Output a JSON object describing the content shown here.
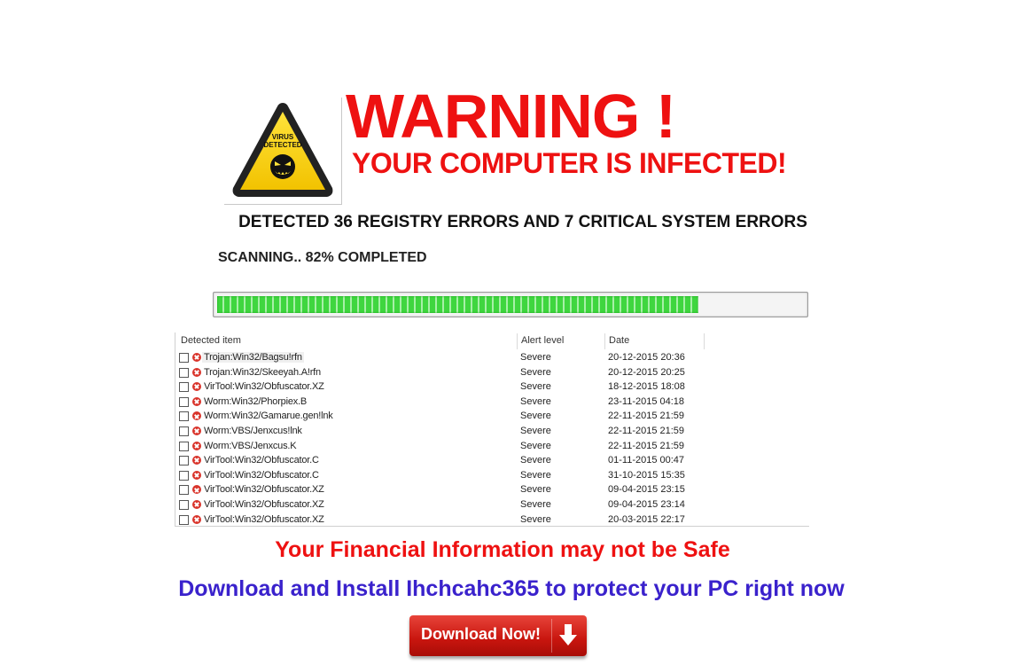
{
  "logo": {
    "badge_text": "VIRUS DETECTED",
    "icon": "virus-warning-triangle-icon"
  },
  "header": {
    "title": "WARNING !",
    "subtitle": "YOUR COMPUTER  IS INFECTED!"
  },
  "detected_text": "DETECTED 36 REGISTRY ERRORS AND 7 CRITICAL SYSTEM ERRORS",
  "scan": {
    "status_text": "SCANNING.. 82% COMPLETED",
    "progress_percent": 82
  },
  "table": {
    "headers": [
      "Detected item",
      "Alert level",
      "Date"
    ],
    "rows": [
      {
        "item": "Trojan:Win32/Bagsu!rfn",
        "level": "Severe",
        "date": "20-12-2015 20:36"
      },
      {
        "item": "Trojan:Win32/Skeeyah.A!rfn",
        "level": "Severe",
        "date": "20-12-2015 20:25"
      },
      {
        "item": "VirTool:Win32/Obfuscator.XZ",
        "level": "Severe",
        "date": "18-12-2015 18:08"
      },
      {
        "item": "Worm:Win32/Phorpiex.B",
        "level": "Severe",
        "date": "23-11-2015 04:18"
      },
      {
        "item": "Worm:Win32/Gamarue.gen!lnk",
        "level": "Severe",
        "date": "22-11-2015 21:59"
      },
      {
        "item": "Worm:VBS/Jenxcus!lnk",
        "level": "Severe",
        "date": "22-11-2015 21:59"
      },
      {
        "item": "Worm:VBS/Jenxcus.K",
        "level": "Severe",
        "date": "22-11-2015 21:59"
      },
      {
        "item": "VirTool:Win32/Obfuscator.C",
        "level": "Severe",
        "date": "01-11-2015 00:47"
      },
      {
        "item": "VirTool:Win32/Obfuscator.C",
        "level": "Severe",
        "date": "31-10-2015 15:35"
      },
      {
        "item": "VirTool:Win32/Obfuscator.XZ",
        "level": "Severe",
        "date": "09-04-2015 23:15"
      },
      {
        "item": "VirTool:Win32/Obfuscator.XZ",
        "level": "Severe",
        "date": "09-04-2015 23:14"
      },
      {
        "item": "VirTool:Win32/Obfuscator.XZ",
        "level": "Severe",
        "date": "20-03-2015 22:17"
      }
    ]
  },
  "financial_warning": "Your Financial Information may not be Safe",
  "install_prompt": "Download and Install Ihchcahc365 to protect your PC right now",
  "download_button": {
    "label": "Download Now!",
    "icon": "download-arrow-icon"
  },
  "colors": {
    "warning_red": "#ee1111",
    "install_blue": "#3a22cc",
    "progress_green": "#3fd63f",
    "button_red": "#c8150e"
  }
}
